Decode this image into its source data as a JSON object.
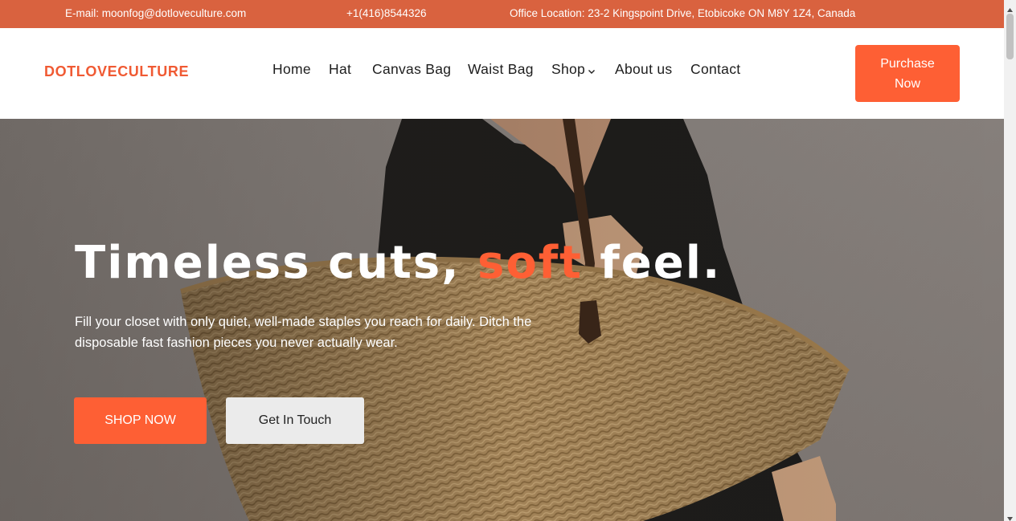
{
  "topbar": {
    "email": "E-mail: moonfog@dotloveculture.com",
    "phone": "+1(416)8544326",
    "location": "Office Location: 23-2 Kingspoint Drive, Etobicoke ON M8Y 1Z4, Canada"
  },
  "header": {
    "logo": "DOTLOVECULTURE",
    "nav": {
      "home": "Home",
      "hat": "Hat",
      "canvas_bag": "Canvas Bag",
      "waist_bag": "Waist Bag",
      "shop": "Shop",
      "about": "About us",
      "contact": "Contact"
    },
    "purchase_label": "Purchase Now"
  },
  "hero": {
    "headline_part1": "Timeless cuts, ",
    "headline_accent": "soft",
    "headline_part2": " feel.",
    "subtext": "Fill your closet with only quiet, well-made staples you reach for daily. Ditch the disposable fast fashion pieces you never actually wear.",
    "shop_button": "SHOP NOW",
    "touch_button": "Get In Touch"
  },
  "icons": {
    "shop_dropdown": "chevron-down-icon",
    "scroll_up": "triangle-up-icon",
    "scroll_down": "triangle-down-icon"
  },
  "colors": {
    "topbar_bg": "#d9623f",
    "accent": "#fe5f34",
    "logo": "#f05a33",
    "secondary_button": "#ebebeb"
  }
}
